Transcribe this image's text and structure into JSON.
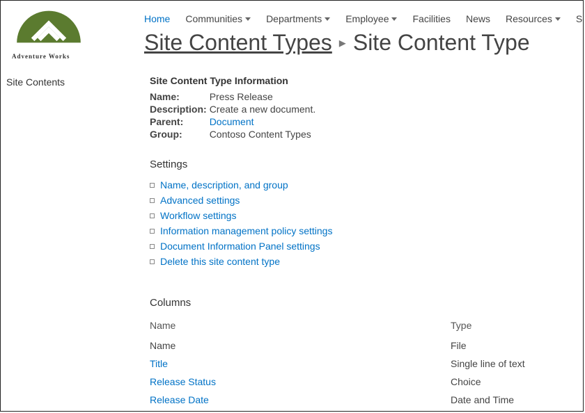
{
  "logo": {
    "alt": "Adventure Works"
  },
  "topnav": {
    "home": "Home",
    "items": [
      {
        "label": "Communities",
        "dropdown": true
      },
      {
        "label": "Departments",
        "dropdown": true
      },
      {
        "label": "Employee",
        "dropdown": true
      },
      {
        "label": "Facilities",
        "dropdown": false
      },
      {
        "label": "News",
        "dropdown": false
      },
      {
        "label": "Resources",
        "dropdown": true
      },
      {
        "label": "Search",
        "dropdown": false
      }
    ]
  },
  "breadcrumb": {
    "parent": "Site Content Types",
    "current": "Site Content Type"
  },
  "leftnav": {
    "items": [
      "Site Contents"
    ]
  },
  "info": {
    "heading": "Site Content Type Information",
    "rows": {
      "name_label": "Name:",
      "name_value": "Press Release",
      "desc_label": "Description:",
      "desc_value": "Create a new document.",
      "parent_label": "Parent:",
      "parent_value": "Document",
      "group_label": "Group:",
      "group_value": "Contoso Content Types"
    }
  },
  "settings": {
    "heading": "Settings",
    "links": [
      "Name, description, and group",
      "Advanced settings",
      "Workflow settings",
      "Information management policy settings",
      "Document Information Panel settings",
      "Delete this site content type"
    ]
  },
  "columns": {
    "heading": "Columns",
    "headers": {
      "name": "Name",
      "type": "Type"
    },
    "rows": [
      {
        "name": "Name",
        "type": "File",
        "link": false
      },
      {
        "name": "Title",
        "type": "Single line of text",
        "link": true
      },
      {
        "name": "Release Status",
        "type": "Choice",
        "link": true
      },
      {
        "name": "Release Date",
        "type": "Date and Time",
        "link": true
      }
    ]
  }
}
